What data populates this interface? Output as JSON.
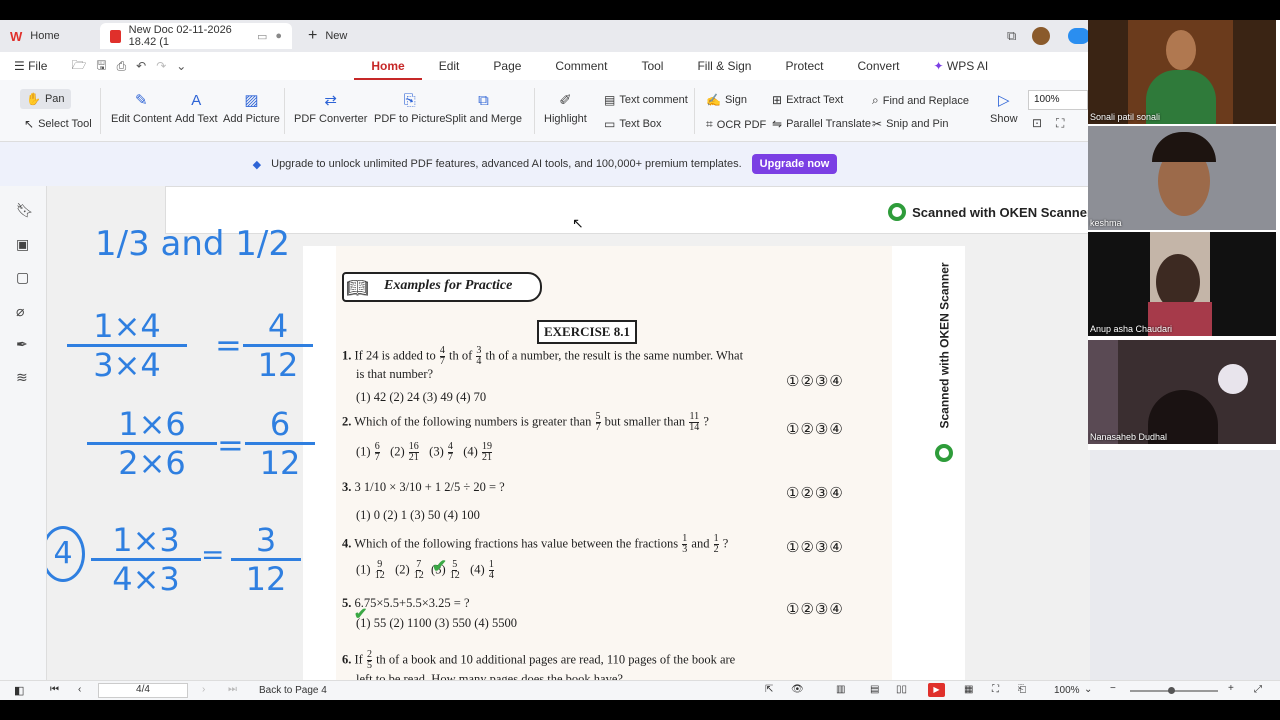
{
  "tabs": [
    {
      "label": "Home"
    },
    {
      "label": "New Doc 02-11-2026 18.42 (1"
    },
    {
      "label": "New"
    }
  ],
  "menu": [
    "File",
    "Home",
    "Edit",
    "Page",
    "Comment",
    "Tool",
    "Fill & Sign",
    "Protect",
    "Convert",
    "WPS AI"
  ],
  "toolbar": {
    "pan": "Pan",
    "select_tool": "Select Tool",
    "edit_content": "Edit Content",
    "add_text": "Add Text",
    "add_picture": "Add Picture",
    "pdf_converter": "PDF Converter",
    "pdf_to_picture": "PDF to Picture",
    "split_merge": "Split and Merge",
    "highlight": "Highlight",
    "text_comment": "Text comment",
    "text_box": "Text Box",
    "sign": "Sign",
    "ocr_pdf": "OCR PDF",
    "extract_text": "Extract Text",
    "parallel_translate": "Parallel Translate",
    "find_replace": "Find and Replace",
    "snip_pin": "Snip and Pin",
    "show": "Show",
    "zoom": "100%"
  },
  "banner": {
    "text": "Upgrade to unlock unlimited PDF features, advanced AI tools, and 100,000+ premium templates.",
    "button": "Upgrade now"
  },
  "scanner_text": "Scanned with OKEN Scanner",
  "document": {
    "heading": "Examples for Practice",
    "exercise": "EXERCISE 8.1",
    "answer_circles": "①②③④",
    "q1": {
      "num": "1.",
      "a": "If 24 is added to",
      "f1n": "4",
      "f1d": "7",
      "b": "th of",
      "f2n": "3",
      "f2d": "4",
      "c": "th of a number, the result is the same number. What",
      "line2": "is that number?",
      "opts": "(1) 42    (2) 24    (3) 49    (4) 70"
    },
    "q2": {
      "num": "2.",
      "a": "Which of the following numbers is greater than",
      "f1n": "5",
      "f1d": "7",
      "b": "but smaller than",
      "f2n": "11",
      "f2d": "14",
      "c": "?",
      "opts": [
        "(1)",
        "6",
        "7",
        "(2)",
        "16",
        "21",
        "(3)",
        "4",
        "7",
        "(4)",
        "19",
        "21"
      ]
    },
    "q3": {
      "num": "3.",
      "text": "3 1/10 × 3/10 + 1 2/5 ÷ 20 = ?",
      "opts": "(1) 0    (2) 1    (3) 50    (4) 100"
    },
    "q4": {
      "num": "4.",
      "a": "Which of the following fractions has value between the fractions",
      "f1n": "1",
      "f1d": "3",
      "b": "and",
      "f2n": "1",
      "f2d": "2",
      "c": "?",
      "opts": [
        "(1)",
        "9",
        "12",
        "(2)",
        "7",
        "12",
        "(3)",
        "5",
        "12",
        "(4)",
        "1",
        "4"
      ]
    },
    "q5": {
      "num": "5.",
      "text": "6.75×5.5+5.5×3.25 = ?",
      "opts": "(1) 55    (2) 1100    (3) 550    (4) 5500"
    },
    "q6": {
      "num": "6.",
      "a": "If",
      "f1n": "2",
      "f1d": "5",
      "b": "th of a book and 10 additional pages are read, 110 pages of the book are",
      "line2": "left to be read. How many pages does the book have?"
    }
  },
  "handwriting": {
    "line1": "1/3 and 1/2",
    "line2_l": "1×4",
    "line2_ld": "3×4",
    "line2_r": "4",
    "line2_rd": "12",
    "line3_l": "1×6",
    "line3_ld": "2×6",
    "line3_r": "6",
    "line3_rd": "12",
    "line4_mark": "4",
    "line4_l": "1×3",
    "line4_ld": "4×3",
    "line4_r": "3",
    "line4_rd": "12"
  },
  "status": {
    "page_input": "4/4",
    "back_to": "Back to Page 4",
    "zoom": "100%"
  },
  "participants": [
    {
      "name": "Sonali patil sonali"
    },
    {
      "name": "keshma"
    },
    {
      "name": "Anup asha Chaudari"
    },
    {
      "name": "Nanasaheb Dudhal"
    }
  ],
  "colors": {
    "accent": "#c62828",
    "upgrade": "#7b3fe4",
    "ink": "#2f7fe0",
    "check": "#3aa845"
  }
}
